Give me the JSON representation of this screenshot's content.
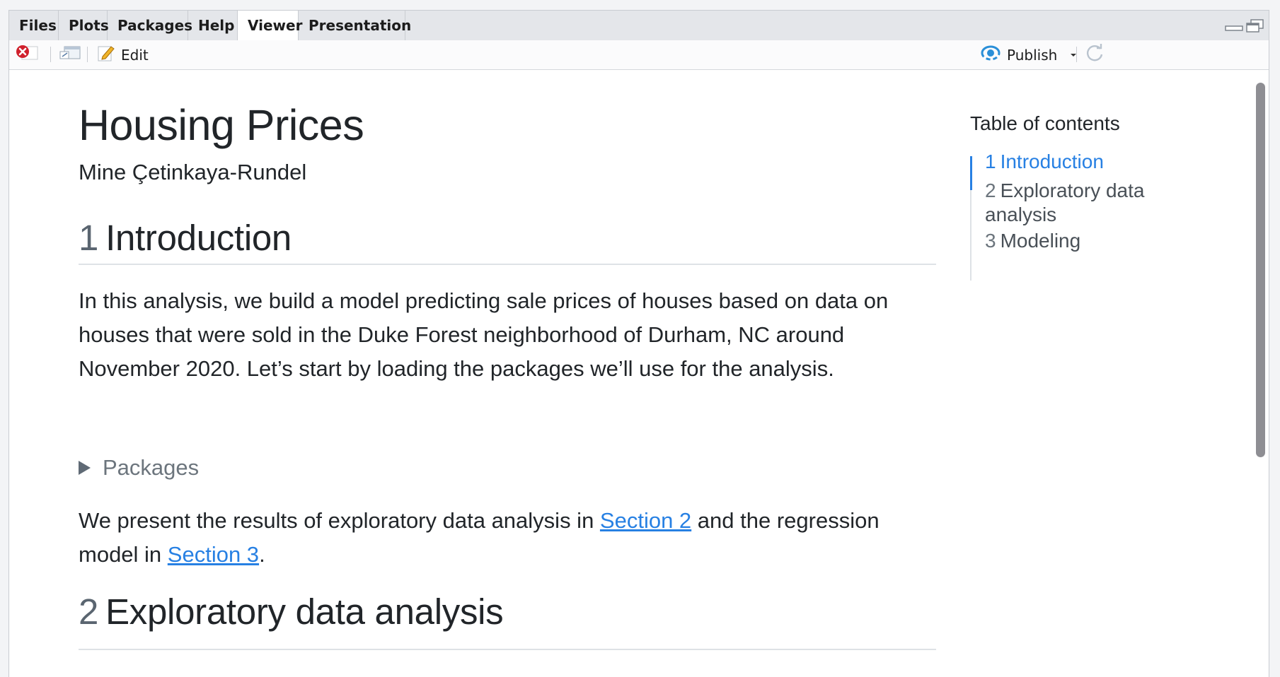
{
  "tabs": [
    "Files",
    "Plots",
    "Packages",
    "Help",
    "Viewer",
    "Presentation"
  ],
  "toolbar": {
    "edit_label": "Edit",
    "publish_label": "Publish"
  },
  "document": {
    "title": "Housing Prices",
    "author": "Mine Çetinkaya-Rundel",
    "sections": [
      {
        "number": "1",
        "title": "Introduction"
      },
      {
        "number": "2",
        "title": "Exploratory data analysis"
      }
    ],
    "intro_paragraph": "In this analysis, we build a model predicting sale prices of houses based on data on houses that were sold in the Duke Forest neighborhood of Durham, NC around November 2020. Let’s start by loading the packages we’ll use for the analysis.",
    "details_summary": "Packages",
    "para2": {
      "before": "We present the results of exploratory data analysis in ",
      "link1": "Section 2",
      "middle": " and the regression model in ",
      "link2": "Section 3",
      "after": "."
    }
  },
  "toc": {
    "title": "Table of contents",
    "items": [
      {
        "number": "1",
        "label": "Introduction"
      },
      {
        "number": "2",
        "label": "Exploratory data analysis"
      },
      {
        "number": "3",
        "label": "Modeling"
      }
    ]
  },
  "colors": {
    "accent": "#2780e3",
    "stop_red": "#d0202c",
    "publish_blue": "#2a8fd8"
  },
  "icons": [
    "stop-icon",
    "show-in-window-icon",
    "edit-icon",
    "publish-icon",
    "dropdown-caret-icon",
    "refresh-icon",
    "minimize-icon",
    "maximize-icon"
  ]
}
